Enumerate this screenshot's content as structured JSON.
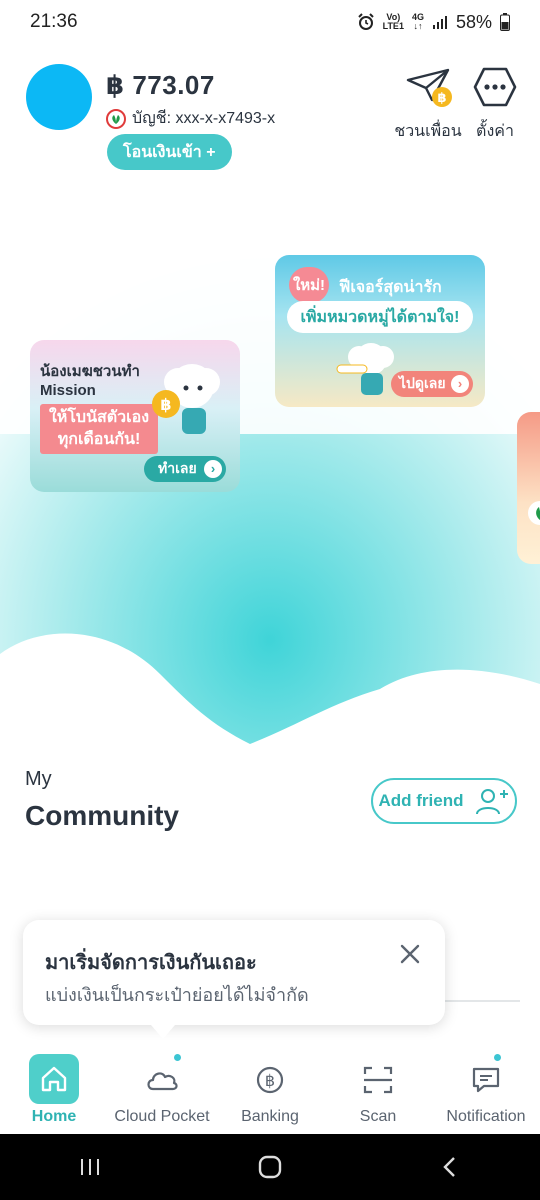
{
  "status_bar": {
    "time": "21:36",
    "network_top": "Vo)",
    "network_bottom": "LTE1",
    "network_type": "4G",
    "battery": "58%"
  },
  "header": {
    "balance": "฿ 773.07",
    "account_label": "บัญชี: xxx-x-x7493-x",
    "deposit_label": "โอนเงินเข้า +",
    "invite_label": "ชวนเพื่อน",
    "settings_label": "ตั้งค่า"
  },
  "banners": [
    {
      "title": "น้องเมฆชวนทำ Mission",
      "highlight": "ให้โบนัสตัวเอง ทุกเดือนกัน!",
      "button": "ทำเลย"
    },
    {
      "badge": "ใหม่!",
      "title": "ฟีเจอร์สุดน่ารัก",
      "highlight": "เพิ่มหมวดหมู่ได้ตามใจ!",
      "button": "ไปดูเลย"
    }
  ],
  "community": {
    "my_label": "My",
    "title": "Community",
    "add_friend_label": "Add friend"
  },
  "tooltip": {
    "title": "มาเริ่มจัดการเงินกันเถอะ",
    "subtitle": "แบ่งเงินเป็นกระเป๋าย่อยได้ไม่จำกัด"
  },
  "nav": [
    {
      "label": "Home",
      "icon": "home-icon",
      "active": true
    },
    {
      "label": "Cloud Pocket",
      "icon": "cloud-icon",
      "dot": true
    },
    {
      "label": "Banking",
      "icon": "baht-icon"
    },
    {
      "label": "Scan",
      "icon": "scan-icon"
    },
    {
      "label": "Notification",
      "icon": "chat-icon",
      "dot": true
    }
  ],
  "colors": {
    "accent": "#47c8c9",
    "avatar": "#0cb8f5",
    "coin": "#f5b820"
  }
}
